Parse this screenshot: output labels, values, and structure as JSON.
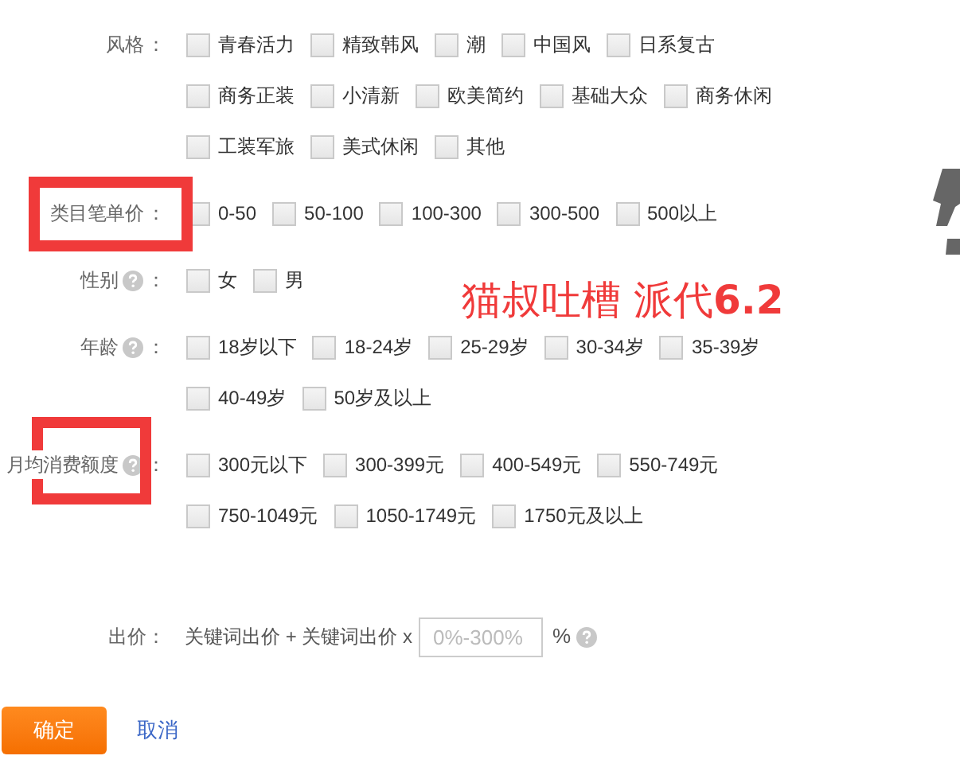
{
  "sections": [
    {
      "label": "风格",
      "help": false,
      "suffix": "：",
      "lines": [
        [
          {
            "label": "青春活力",
            "checked": false
          },
          {
            "label": "精致韩风",
            "checked": false
          },
          {
            "label": "潮",
            "checked": false
          },
          {
            "label": "中国风",
            "checked": false
          },
          {
            "label": "日系复古",
            "checked": false
          }
        ],
        [
          {
            "label": "商务正装",
            "checked": false
          },
          {
            "label": "小清新",
            "checked": false
          },
          {
            "label": "欧美简约",
            "checked": false
          },
          {
            "label": "基础大众",
            "checked": false
          },
          {
            "label": "商务休闲",
            "checked": false
          }
        ],
        [
          {
            "label": "工装军旅",
            "checked": false
          },
          {
            "label": "美式休闲",
            "checked": false
          },
          {
            "label": "其他",
            "checked": false
          }
        ]
      ]
    },
    {
      "label": "类目笔单价",
      "help": false,
      "suffix": "：",
      "lines": [
        [
          {
            "label": "0-50",
            "checked": false
          },
          {
            "label": "50-100",
            "checked": false
          },
          {
            "label": "100-300",
            "checked": false
          },
          {
            "label": "300-500",
            "checked": false
          },
          {
            "label": "500以上",
            "checked": false
          }
        ]
      ]
    },
    {
      "label": "性别",
      "help": true,
      "suffix": "：",
      "lines": [
        [
          {
            "label": "女",
            "checked": false
          },
          {
            "label": "男",
            "checked": false
          }
        ]
      ]
    },
    {
      "label": "年龄",
      "help": true,
      "suffix": "：",
      "lines": [
        [
          {
            "label": "18岁以下",
            "checked": false
          },
          {
            "label": "18-24岁",
            "checked": false
          },
          {
            "label": "25-29岁",
            "checked": false
          },
          {
            "label": "30-34岁",
            "checked": false
          },
          {
            "label": "35-39岁",
            "checked": false
          }
        ],
        [
          {
            "label": "40-49岁",
            "checked": false
          },
          {
            "label": "50岁及以上",
            "checked": false
          }
        ]
      ]
    },
    {
      "label": "月均消费额度",
      "help": true,
      "suffix": "：",
      "lines": [
        [
          {
            "label": "300元以下",
            "checked": false
          },
          {
            "label": "300-399元",
            "checked": false
          },
          {
            "label": "400-549元",
            "checked": false
          },
          {
            "label": "550-749元",
            "checked": false
          }
        ],
        [
          {
            "label": "750-1049元",
            "checked": false
          },
          {
            "label": "1050-1749元",
            "checked": false
          },
          {
            "label": "1750元及以上",
            "checked": false
          }
        ]
      ]
    }
  ],
  "bid": {
    "label": "出价：",
    "formula": "关键词出价 + 关键词出价 x",
    "placeholder": "0%-300%",
    "unit": "%",
    "help": true
  },
  "buttons": {
    "confirm": "确定",
    "cancel": "取消"
  },
  "annotation": {
    "text": "猫叔吐槽 派代**6.2**"
  }
}
